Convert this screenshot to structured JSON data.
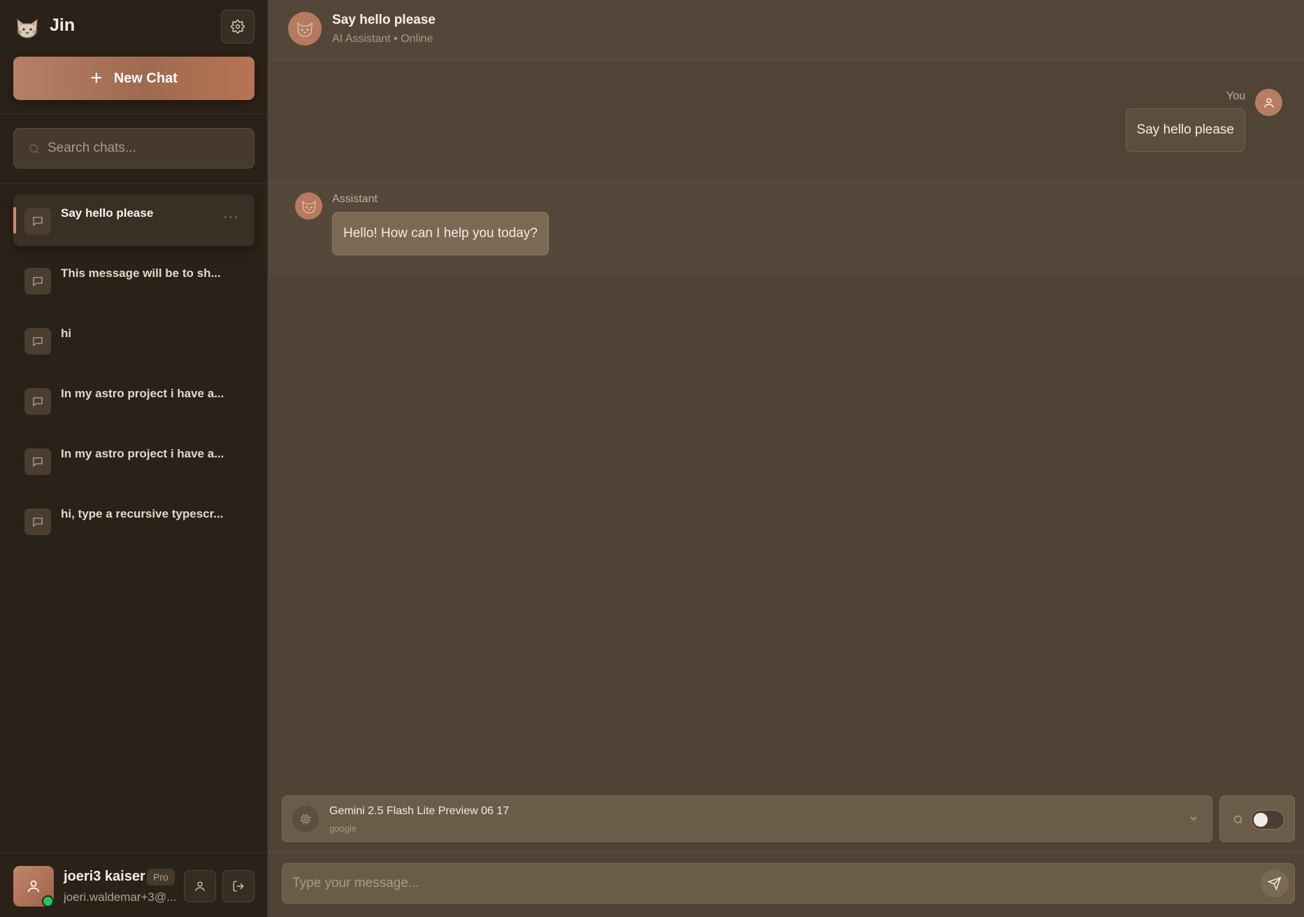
{
  "app": {
    "name": "Jin"
  },
  "sidebar": {
    "new_chat_label": "New Chat",
    "search_placeholder": "Search chats...",
    "chats": [
      {
        "title": "Say hello please",
        "active": true
      },
      {
        "title": "This message will be to sh...",
        "active": false
      },
      {
        "title": "hi",
        "active": false
      },
      {
        "title": "In my astro project i have a...",
        "active": false
      },
      {
        "title": "In my astro project i have a...",
        "active": false
      },
      {
        "title": "hi, type a recursive typescr...",
        "active": false
      }
    ],
    "more_label": "···"
  },
  "user": {
    "name": "joeri3 kaiser",
    "plan": "Pro",
    "email": "joeri.waldemar+3@...",
    "status": "online"
  },
  "header": {
    "title": "Say hello please",
    "subtitle": "AI Assistant • Online"
  },
  "messages": [
    {
      "role": "user",
      "sender_label": "You",
      "text": "Say hello please"
    },
    {
      "role": "assistant",
      "sender_label": "Assistant",
      "text": "Hello! How can I help you today?"
    }
  ],
  "model": {
    "name": "Gemini 2.5 Flash Lite Preview 06 17",
    "provider": "google",
    "web_search_enabled": false
  },
  "composer": {
    "placeholder": "Type your message..."
  },
  "colors": {
    "accent": "#b67a60",
    "sidebar_bg": "#2a2119",
    "main_bg": "#4e4335",
    "online": "#22c55e"
  }
}
